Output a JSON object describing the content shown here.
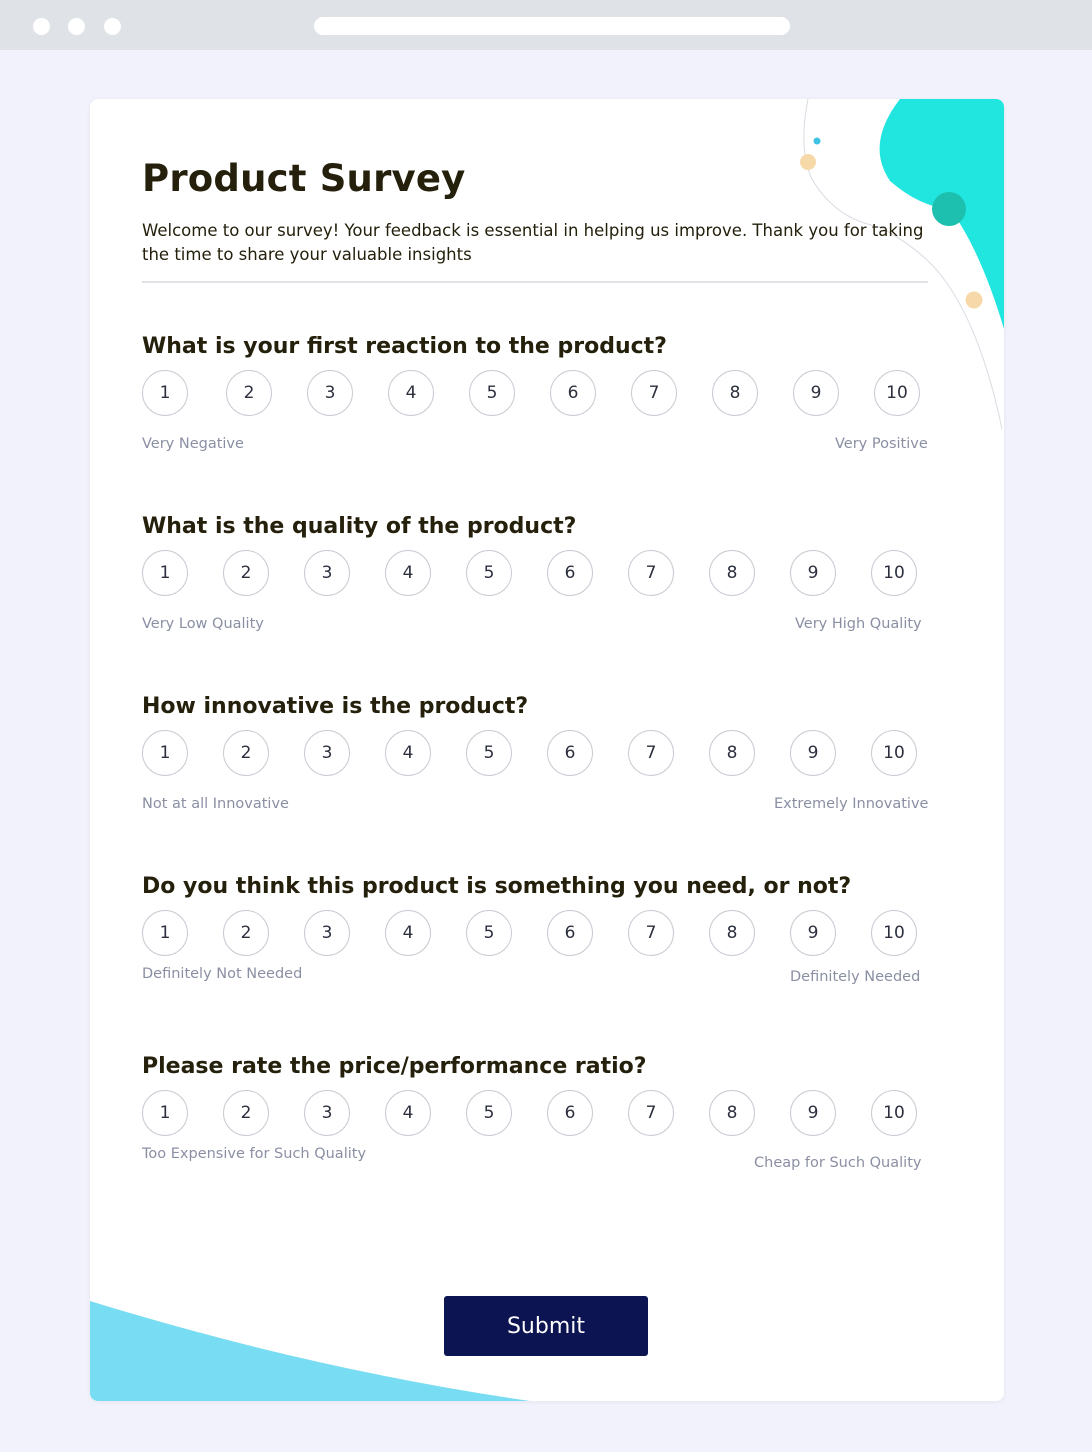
{
  "survey": {
    "title": "Product Survey",
    "intro": "Welcome to our survey! Your feedback is essential in helping us improve. Thank you for taking the time to share your valuable insights",
    "submit_label": "Submit",
    "questions": [
      {
        "text": "What is your first reaction to the product?",
        "low_label": "Very Negative",
        "high_label": "Very Positive",
        "options": [
          "1",
          "2",
          "3",
          "4",
          "5",
          "6",
          "7",
          "8",
          "9",
          "10"
        ]
      },
      {
        "text": "What is the quality of the product?",
        "low_label": "Very Low Quality",
        "high_label": "Very High Quality",
        "options": [
          "1",
          "2",
          "3",
          "4",
          "5",
          "6",
          "7",
          "8",
          "9",
          "10"
        ]
      },
      {
        "text": "How innovative is the product?",
        "low_label": "Not at all Innovative",
        "high_label": "Extremely Innovative",
        "options": [
          "1",
          "2",
          "3",
          "4",
          "5",
          "6",
          "7",
          "8",
          "9",
          "10"
        ]
      },
      {
        "text": "Do you think this product is something you need, or not?",
        "low_label": "Definitely Not Needed",
        "high_label": "Definitely Needed",
        "options": [
          "1",
          "2",
          "3",
          "4",
          "5",
          "6",
          "7",
          "8",
          "9",
          "10"
        ]
      },
      {
        "text": "Please rate the price/performance ratio?",
        "low_label": "Too Expensive for Such Quality",
        "high_label": "Cheap for Such Quality",
        "options": [
          "1",
          "2",
          "3",
          "4",
          "5",
          "6",
          "7",
          "8",
          "9",
          "10"
        ]
      }
    ]
  },
  "colors": {
    "background": "#f1f2fb",
    "accent_cyan": "#21e6e0",
    "accent_teal": "#1dbfae",
    "accent_blue": "#78dcf2",
    "accent_peach": "#f7d9a9",
    "button": "#0d1452"
  }
}
